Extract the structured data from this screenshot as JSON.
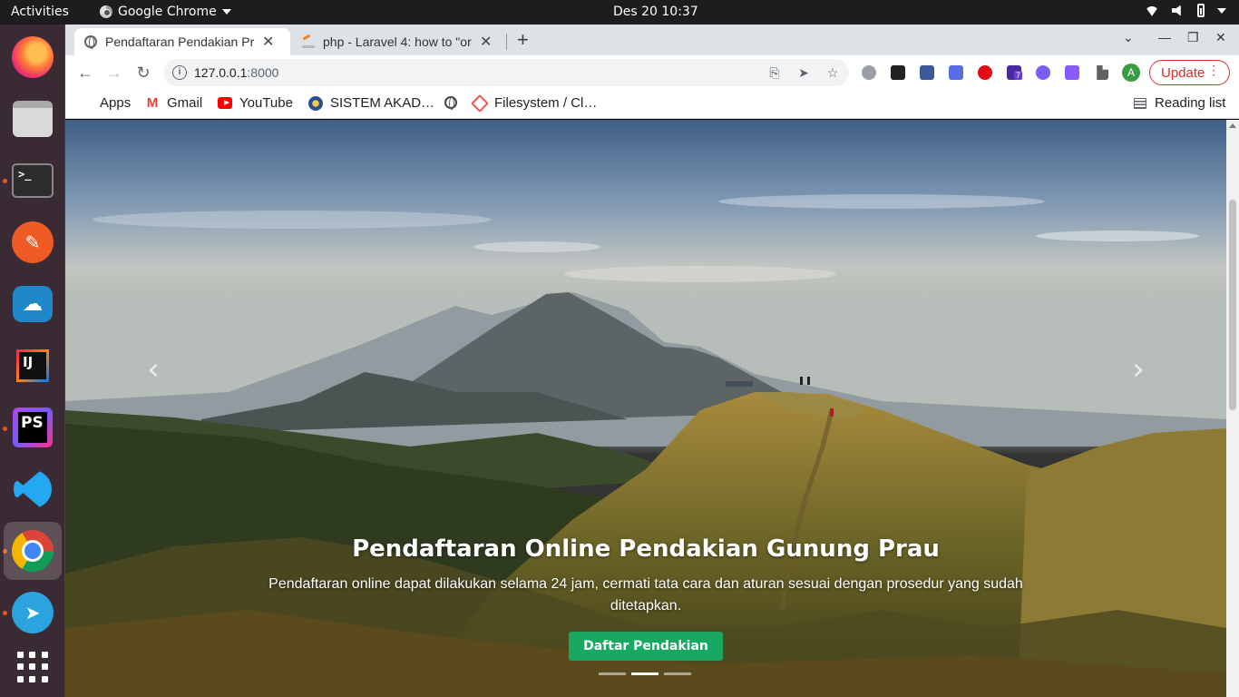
{
  "topbar": {
    "activities": "Activities",
    "app_name": "Google Chrome",
    "clock": "Des 20  10:37"
  },
  "dock": {
    "items": [
      "Firefox",
      "Files",
      "Terminal",
      "Postman",
      "Cloud",
      "IntelliJ IDEA",
      "PhpStorm",
      "Visual Studio Code",
      "Google Chrome",
      "Telegram",
      "Show Applications"
    ]
  },
  "browser": {
    "tabs": [
      {
        "title": "Pendaftaran Pendakian Prau",
        "icon": "globe-icon"
      },
      {
        "title": "php - Laravel 4: how to \"or",
        "icon": "stackoverflow-icon"
      }
    ],
    "url_host": "127.0.0.1",
    "url_port": ":8000",
    "profile_initial": "A",
    "update_label": "Update",
    "bookmarks": [
      {
        "label": "Apps",
        "icon": "apps-icon"
      },
      {
        "label": "Gmail",
        "icon": "gmail-icon"
      },
      {
        "label": "YouTube",
        "icon": "youtube-icon"
      },
      {
        "label": "SISTEM AKAD…",
        "icon": "university-icon"
      },
      {
        "label": "",
        "icon": "globe-icon"
      },
      {
        "label": "Filesystem / Cl…",
        "icon": "laravel-icon"
      }
    ],
    "reading_list": "Reading list",
    "extension_badge": "7"
  },
  "page": {
    "hero_title": "Pendaftaran Online Pendakian Gunung Prau",
    "hero_text": "Pendaftaran online dapat dilakukan selama 24 jam, cermati tata cara dan aturan sesuai dengan prosedur yang sudah ditetapkan.",
    "cta_label": "Daftar Pendakian",
    "carousel_slides": 3,
    "active_slide": 2,
    "prev_arrow": "‹",
    "next_arrow": "›"
  },
  "colors": {
    "cta": "#19a861",
    "update": "#d93025",
    "dock_bg": "#3a2a33"
  }
}
